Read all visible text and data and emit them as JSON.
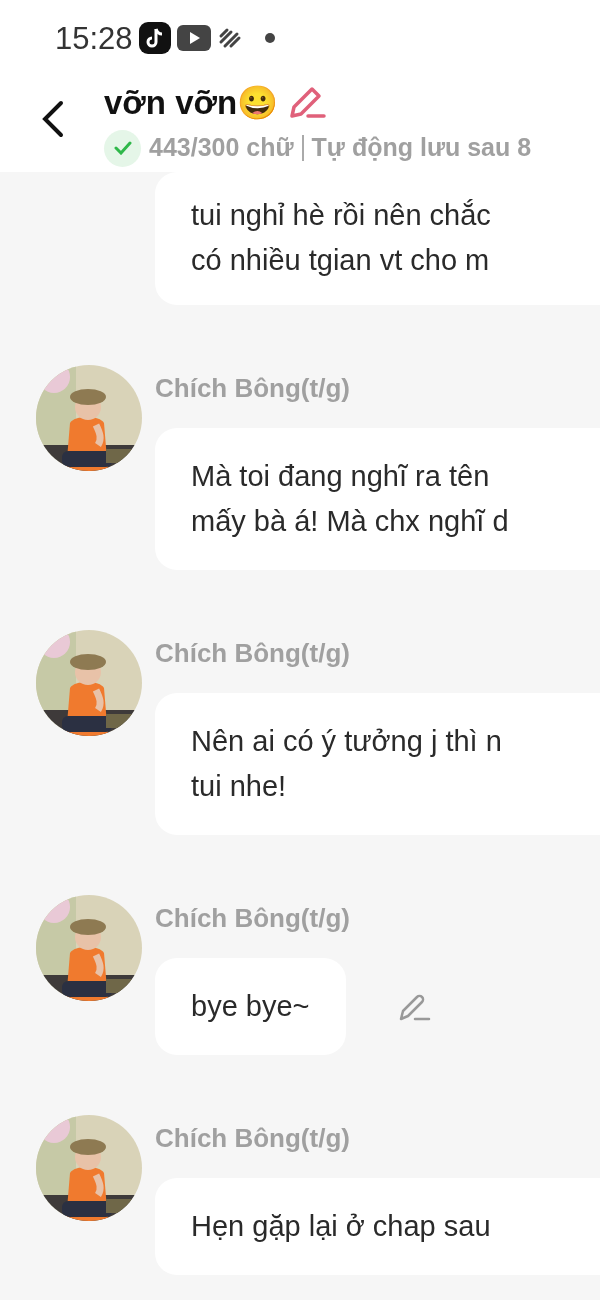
{
  "status_bar": {
    "time": "15:28"
  },
  "header": {
    "title": "vỡn vỡn😀",
    "counter": "443/300 chữ",
    "autosave": "Tự động lưu sau 8",
    "saved": true
  },
  "messages": [
    {
      "kind": "continued",
      "lines": [
        "tui nghỉ hè rồi nên chắc",
        "có nhiều tgian vt cho m"
      ],
      "clipped": true,
      "edit_icon": false
    },
    {
      "kind": "full",
      "sender": "Chích Bông(t/g)",
      "lines": [
        "Mà toi đang nghĩ ra tên",
        "mấy bà á! Mà chx nghĩ d"
      ],
      "clipped": true,
      "edit_icon": false
    },
    {
      "kind": "full",
      "sender": "Chích Bông(t/g)",
      "lines": [
        "Nên ai có ý tưởng j thì n",
        "tui nhe!"
      ],
      "clipped": true,
      "edit_icon": false
    },
    {
      "kind": "full",
      "sender": "Chích Bông(t/g)",
      "lines": [
        "bye bye~"
      ],
      "clipped": false,
      "edit_icon": true
    },
    {
      "kind": "full",
      "sender": "Chích Bông(t/g)",
      "lines": [
        "Hẹn gặp lại ở chap sau"
      ],
      "clipped": true,
      "edit_icon": false
    }
  ]
}
